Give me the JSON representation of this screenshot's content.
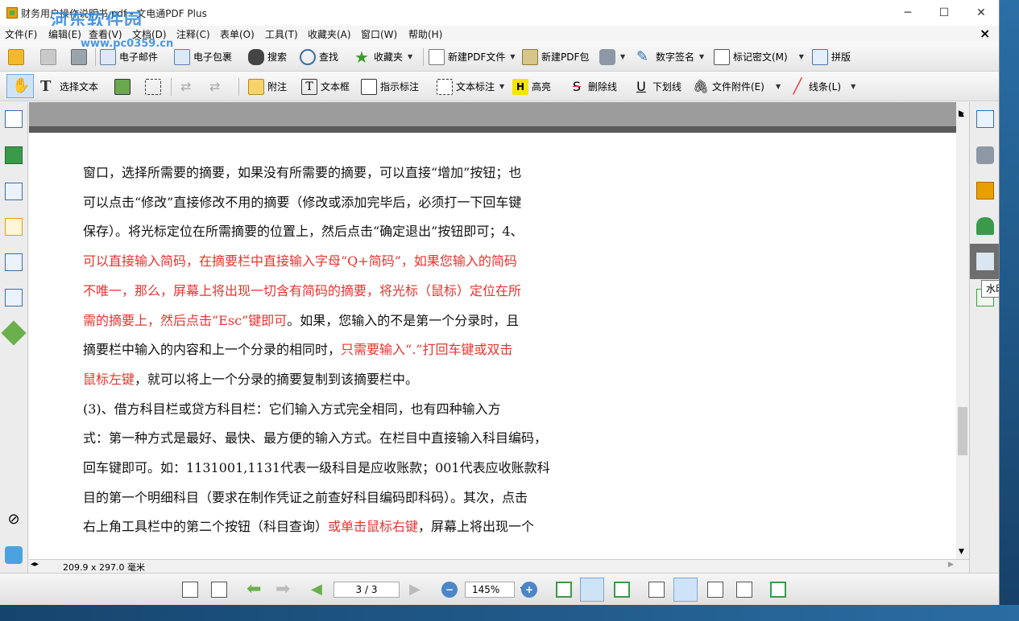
{
  "window": {
    "title": "财务用户操作说明书.pdf - 文电通PDF Plus",
    "watermark_text": "河东软件园",
    "watermark_url": "www.pc0359.cn",
    "minimize": "─",
    "maximize": "☐",
    "close": "✕"
  },
  "menu": [
    "文件(F)",
    "编辑(E)",
    "查看(V)",
    "文档(D)",
    "注释(C)",
    "表单(O)",
    "工具(T)",
    "收藏夹(A)",
    "窗口(W)",
    "帮助(H)"
  ],
  "menu_close": "×",
  "toolbar1": {
    "email": "电子邮件",
    "package": "电子包裹",
    "search": "搜索",
    "find": "查找",
    "favorites": "收藏夹",
    "new_pdf": "新建PDF文件",
    "new_pdf_package": "新建PDF包",
    "digital_signature": "数字签名",
    "mark_redaction": "标记密文(M)",
    "imposition": "拼版"
  },
  "toolbar2": {
    "select_text": "选择文本",
    "note": "附注",
    "textbox": "文本框",
    "callout": "指示标注",
    "text_markup": "文本标注",
    "highlight": "高亮",
    "strikethrough": "删除线",
    "underline": "下划线",
    "file_attachment": "文件附件(E)",
    "line": "线条(L)"
  },
  "tooltip": "水印",
  "status": {
    "page_size": "209.9 x 297.0 毫米"
  },
  "nav": {
    "page": "3 / 3",
    "zoom": "145%"
  },
  "document": {
    "lines": [
      {
        "parts": [
          {
            "text": "窗口，选择所需要的摘要，如果没有所需要的摘要，可以直接“增加”按钮；也",
            "red": false
          }
        ]
      },
      {
        "parts": [
          {
            "text": "可以点击“修改”直接修改不用的摘要（修改或添加完毕后，必须打一下回车键",
            "red": false
          }
        ]
      },
      {
        "parts": [
          {
            "text": "保存）。将光标定位在所需摘要的位置上，然后点击“确定退出”按钮即可；4、",
            "red": false
          }
        ]
      },
      {
        "parts": [
          {
            "text": "可以直接输入简码，在摘要栏中直接输入字母“Q+简码”，如果您输入的简码",
            "red": true
          }
        ]
      },
      {
        "parts": [
          {
            "text": "不唯一，那么，屏幕上将出现一切含有简码的摘要，将光标（鼠标）定位在所",
            "red": true
          }
        ]
      },
      {
        "parts": [
          {
            "text": "需的摘要上，然后点击“Esc”键即可",
            "red": true
          },
          {
            "text": "。如果，您输入的不是第一个分录时，且",
            "red": false
          }
        ]
      },
      {
        "parts": [
          {
            "text": "摘要栏中输入的内容和上一个分录的相同时，",
            "red": false
          },
          {
            "text": "只需要输入“.”打回车键或双击",
            "red": true
          }
        ]
      },
      {
        "parts": [
          {
            "text": "鼠标左键",
            "red": true
          },
          {
            "text": "，就可以将上一个分录的摘要复制到该摘要栏中。",
            "red": false
          }
        ]
      },
      {
        "parts": [
          {
            "text": "(3)、借方科目栏或贷方科目栏：它们输入方式完全相同，也有四种输入方",
            "red": false
          }
        ]
      },
      {
        "parts": [
          {
            "text": "式：第一种方式是最好、最快、最方便的输入方式。在栏目中直接输入科目编码，",
            "red": false
          }
        ]
      },
      {
        "parts": [
          {
            "text": "回车键即可。如：1131001,1131代表一级科目是应收账款；001代表应收账款科",
            "red": false
          }
        ]
      },
      {
        "parts": [
          {
            "text": "目的第一个明细科目（要求在制作凭证之前查好科目编码即科码）。其次，点击",
            "red": false
          }
        ]
      },
      {
        "parts": [
          {
            "text": "右上角工具栏中的第二个按钮（科目查询）",
            "red": false
          },
          {
            "text": "或单击鼠标右键",
            "red": true
          },
          {
            "text": "，屏幕上将出现一个",
            "red": false
          }
        ]
      }
    ]
  },
  "colors": {
    "red_text": "#e8332f",
    "page_band": "#5b5b5b",
    "doc_bg": "#9c9c9c"
  }
}
